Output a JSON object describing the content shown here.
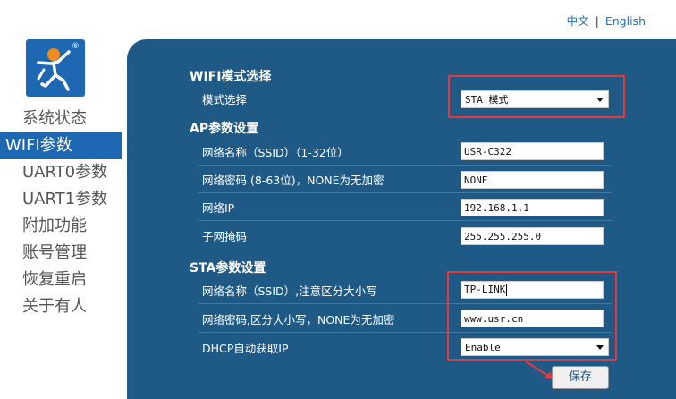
{
  "lang": {
    "zh": "中文",
    "en": "English"
  },
  "nav": [
    {
      "label": "系统状态",
      "active": false
    },
    {
      "label": "WIFI参数",
      "active": true
    },
    {
      "label": "UART0参数",
      "active": false
    },
    {
      "label": "UART1参数",
      "active": false
    },
    {
      "label": "附加功能",
      "active": false
    },
    {
      "label": "账号管理",
      "active": false
    },
    {
      "label": "恢复重启",
      "active": false
    },
    {
      "label": "关于有人",
      "active": false
    }
  ],
  "logo": {
    "reg": "®"
  },
  "wifi_mode": {
    "title": "WIFI模式选择",
    "label": "模式选择",
    "value": "STA 模式"
  },
  "ap": {
    "title": "AP参数设置",
    "ssid_label": "网络名称（SSID）（1-32位）",
    "ssid_value": "USR-C322",
    "pwd_label": "网络密码 (8-63位)，NONE为无加密",
    "pwd_value": "NONE",
    "ip_label": "网络IP",
    "ip_value": "192.168.1.1",
    "mask_label": "子网掩码",
    "mask_value": "255.255.255.0"
  },
  "sta": {
    "title": "STA参数设置",
    "ssid_label": "网络名称（SSID）,注意区分大小写",
    "ssid_value": "TP-LINK",
    "pwd_label": "网络密码,区分大小写，NONE为无加密",
    "pwd_value": "www.usr.cn",
    "dhcp_label": "DHCP自动获取IP",
    "dhcp_value": "Enable"
  },
  "save_label": "保存",
  "colors": {
    "panel": "#1f5a86",
    "accent": "#1d67b3",
    "highlight": "#e23b3b"
  }
}
